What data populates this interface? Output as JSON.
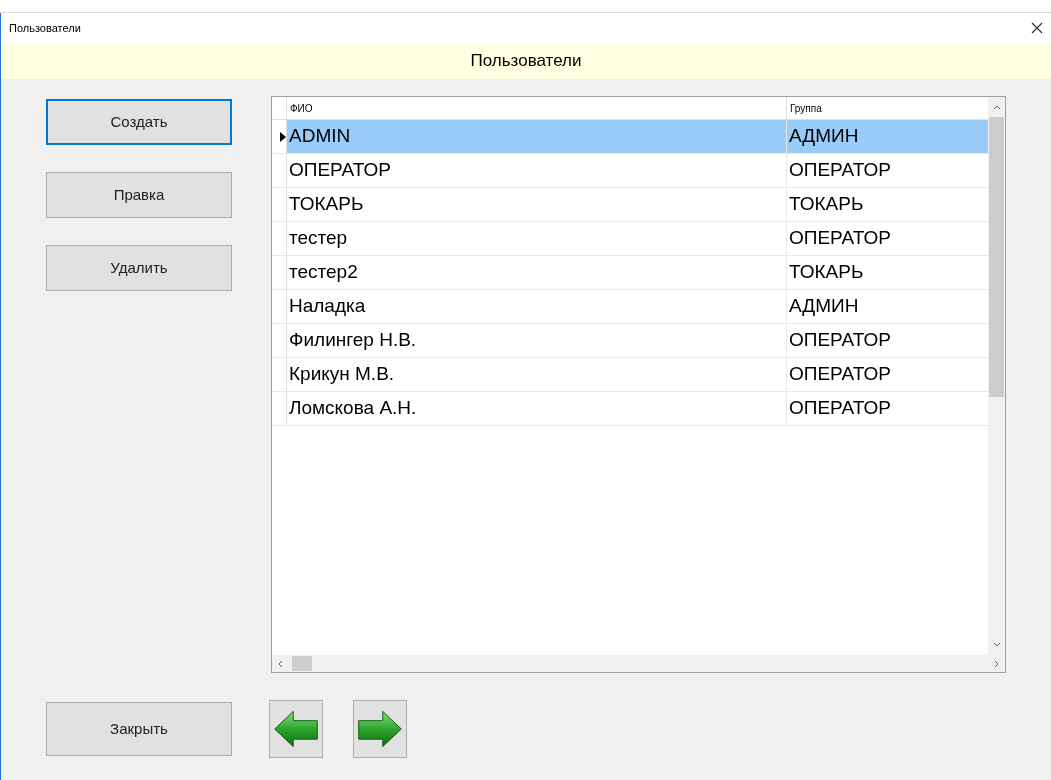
{
  "window": {
    "title": "Пользователи"
  },
  "banner": "Пользователи",
  "actions": [
    {
      "label": "Создать",
      "default": true
    },
    {
      "label": "Правка",
      "default": false
    },
    {
      "label": "Удалить",
      "default": false
    }
  ],
  "table": {
    "columns": [
      "ФИО",
      "Группа"
    ],
    "rows": [
      {
        "cells": [
          "ADMIN",
          "АДМИН"
        ],
        "selected": true
      },
      {
        "cells": [
          "ОПЕРАТОР",
          "ОПЕРАТОР"
        ],
        "selected": false
      },
      {
        "cells": [
          "ТОКАРЬ",
          "ТОКАРЬ"
        ],
        "selected": false
      },
      {
        "cells": [
          "тестер",
          "ОПЕРАТОР"
        ],
        "selected": false
      },
      {
        "cells": [
          "тестер2",
          "ТОКАРЬ"
        ],
        "selected": false
      },
      {
        "cells": [
          "Наладка",
          "АДМИН"
        ],
        "selected": false
      },
      {
        "cells": [
          "Филингер Н.В.",
          "ОПЕРАТОР"
        ],
        "selected": false
      },
      {
        "cells": [
          "Крикун М.В.",
          "ОПЕРАТОР"
        ],
        "selected": false
      },
      {
        "cells": [
          "Ломскова А.Н.",
          "ОПЕРАТОР"
        ],
        "selected": false
      }
    ]
  },
  "close_button": "Закрыть"
}
